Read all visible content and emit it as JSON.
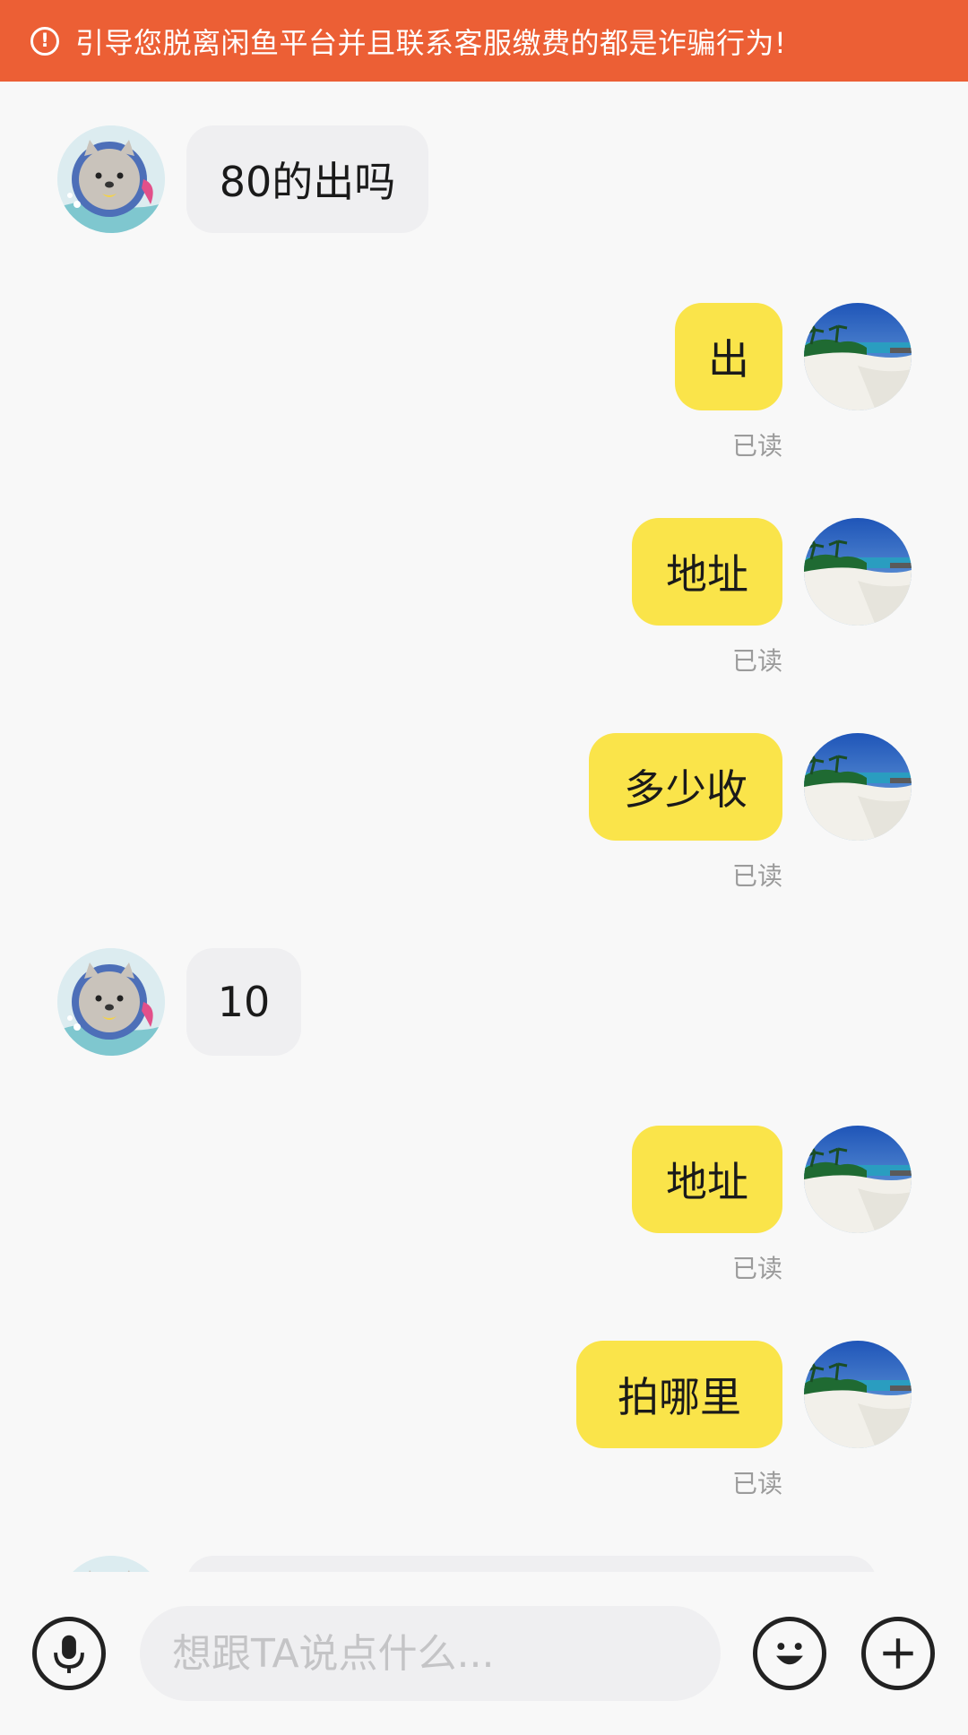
{
  "banner": {
    "text": "引导您脱离闲鱼平台并且联系客服缴费的都是诈骗行为!",
    "icon": "exclamation-circle-icon",
    "color": "#ec5f35"
  },
  "messages": [
    {
      "side": "in",
      "text": "80的出吗"
    },
    {
      "side": "out",
      "text": "出",
      "status": "已读"
    },
    {
      "side": "out",
      "text": "地址",
      "status": "已读"
    },
    {
      "side": "out",
      "text": "多少收",
      "status": "已读"
    },
    {
      "side": "in",
      "text": "10"
    },
    {
      "side": "out",
      "text": "地址",
      "status": "已读"
    },
    {
      "side": "out",
      "text": "拍哪里",
      "status": "已读"
    }
  ],
  "input_bar": {
    "placeholder": "想跟TA说点什么...",
    "voice_icon": "microphone-icon",
    "emoji_icon": "smiley-icon",
    "add_icon": "plus-circle-icon"
  },
  "colors": {
    "incoming_bubble": "#efeff1",
    "outgoing_bubble": "#fae44a",
    "background": "#f8f8f8"
  }
}
